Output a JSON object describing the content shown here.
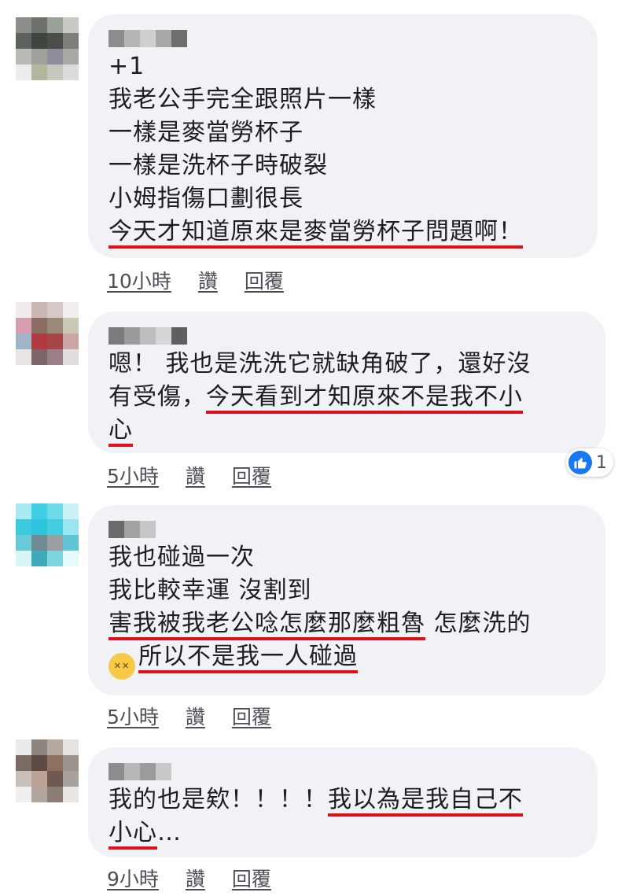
{
  "comments": [
    {
      "lines": [
        [
          {
            "t": "+1"
          }
        ],
        [
          {
            "t": "我老公手完全跟照片一樣"
          }
        ],
        [
          {
            "t": "一樣是麥當勞杯子"
          }
        ],
        [
          {
            "t": "一樣是洗杯子時破裂"
          }
        ],
        [
          {
            "t": "小姆指傷口劃很長"
          }
        ],
        [
          {
            "t": "今天才知道原來是麥當勞杯子問題啊！",
            "u": true
          }
        ]
      ],
      "time": "10小時",
      "like": "讚",
      "reply": "回覆"
    },
    {
      "lines": [
        [
          {
            "t": "嗯！ 我也是洗洗它就缺角破了，還好沒"
          }
        ],
        [
          {
            "t": "有受傷，"
          },
          {
            "t": "今天看到才知原來不是我不小",
            "u": true
          }
        ],
        [
          {
            "t": "心",
            "u": true
          }
        ]
      ],
      "time": "5小時",
      "like": "讚",
      "reply": "回覆",
      "reaction_count": "1"
    },
    {
      "lines": [
        [
          {
            "t": "我也碰過一次"
          }
        ],
        [
          {
            "t": "我比較幸運 沒割到"
          }
        ],
        [
          {
            "t": "害我被我老公唸怎麼那麼粗魯",
            "u": true
          },
          {
            "t": " 怎麼洗的"
          }
        ],
        [
          {
            "emoji": "dizzy-face"
          },
          {
            "t": "所以不是我一人碰過",
            "u": true
          }
        ]
      ],
      "time": "5小時",
      "like": "讚",
      "reply": "回覆"
    },
    {
      "lines": [
        [
          {
            "t": "我的也是欸！！！！"
          },
          {
            "t": "我以為是我自己不",
            "u": true
          }
        ],
        [
          {
            "t": "小心",
            "u": true
          },
          {
            "t": "…"
          }
        ]
      ],
      "time": "9小時",
      "like": "讚",
      "reply": "回覆"
    }
  ],
  "colors": {
    "underline": "#e0101b",
    "bubble": "#f0f2f5",
    "like_blue": "#1877f2"
  }
}
